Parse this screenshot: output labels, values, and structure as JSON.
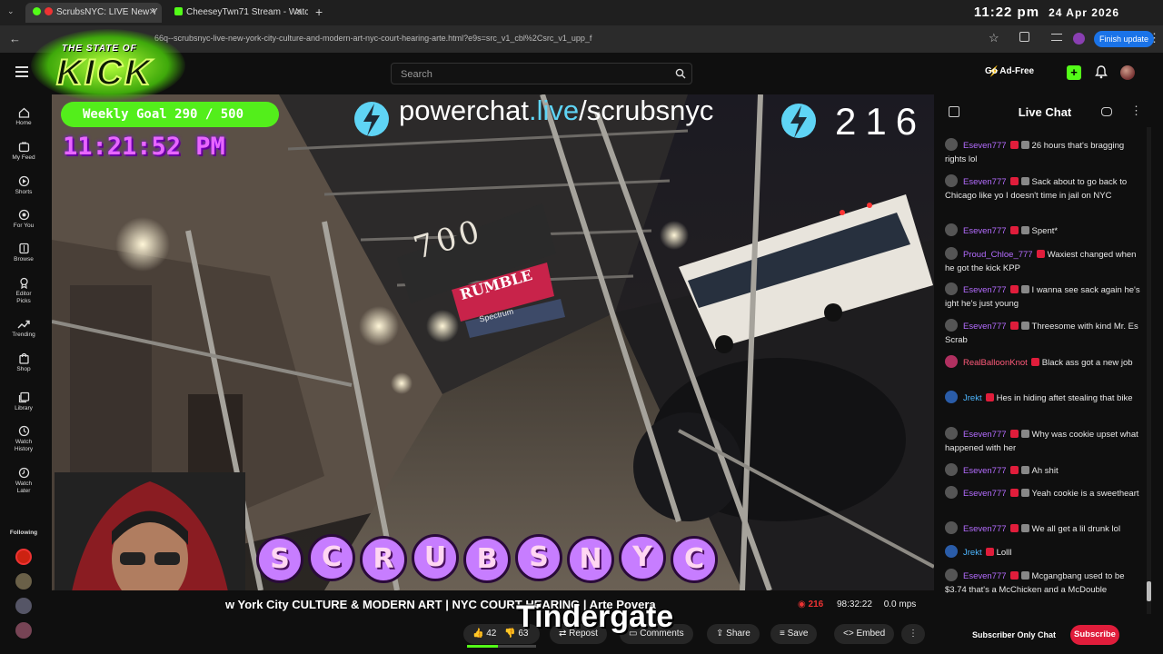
{
  "browser": {
    "tabs": [
      {
        "title": "ScrubsNYC: LIVE New Y",
        "active": true
      },
      {
        "title": "CheeseyTwn71 Stream - Watch",
        "active": false
      }
    ],
    "url": "66q--scrubsnyc-live-new-york-city-culture-and-modern-art-nyc-court-hearing-arte.html?e9s=src_v1_cbl%2Csrc_v1_upp_f",
    "finish_update": "Finish update",
    "clock_time": "11:22 pm",
    "clock_date": "24 Apr 2026"
  },
  "header": {
    "search_placeholder": "Search",
    "go_ad_free": "Go Ad-Free",
    "logo_text_top": "THE STATE OF",
    "logo_text_main": "KICK"
  },
  "sidebar": {
    "items": [
      {
        "label": "Home",
        "icon": "home-icon"
      },
      {
        "label": "My Feed",
        "icon": "feed-icon"
      },
      {
        "label": "Shorts",
        "icon": "shorts-icon"
      },
      {
        "label": "For You",
        "icon": "for-you-icon"
      },
      {
        "label": "Browse",
        "icon": "browse-icon"
      },
      {
        "label": "Editor Picks",
        "icon": "editor-picks-icon"
      },
      {
        "label": "Trending",
        "icon": "trending-icon"
      },
      {
        "label": "Shop",
        "icon": "shop-icon"
      },
      {
        "label": "Library",
        "icon": "library-icon"
      },
      {
        "label": "Watch History",
        "icon": "watch-history-icon"
      },
      {
        "label": "Watch Later",
        "icon": "watch-later-icon"
      }
    ],
    "following_label": "Following"
  },
  "overlay": {
    "weekly_goal": "Weekly Goal 290 / 500",
    "stream_time": "11:21:52 PM",
    "powerchat_prefix": "powerchat",
    "powerchat_tld": ".live",
    "powerchat_path": "/scrubsnyc",
    "viewer_counter": "216",
    "letters": [
      "S",
      "C",
      "R",
      "U",
      "B",
      "S",
      "N",
      "Y",
      "C"
    ],
    "sign_number": "700",
    "sign_rumble": "RUMBLE",
    "sign_spectrum": "Spectrum",
    "tindergate": "Tindergate"
  },
  "stream": {
    "title_visible": "w York City  CULTURE & MODERN ART | NYC COURT HEARING | Arte Povera",
    "viewers": "216",
    "duration": "98:32:22",
    "bitrate": "0.0 mps",
    "likes": "42",
    "dislikes": "63",
    "repost_label": "Repost",
    "comments_label": "Comments",
    "share_label": "Share",
    "save_label": "Save",
    "embed_label": "Embed"
  },
  "chat": {
    "title": "Live Chat",
    "messages": [
      {
        "user": "Eseven777",
        "color": "#b46cff",
        "text": "26 hours that's bragging rights lol"
      },
      {
        "user": "Eseven777",
        "color": "#b46cff",
        "text": "Sack about to go back to Chicago like yo I doesn't time in jail on NYC"
      },
      {
        "user": "Eseven777",
        "color": "#b46cff",
        "text": "Spent*"
      },
      {
        "user": "Proud_Chloe_777",
        "color": "#b46cff",
        "text": "Waxiest changed when he got the kick KPP"
      },
      {
        "user": "Eseven777",
        "color": "#b46cff",
        "text": "I wanna see sack again he's ight he's just young"
      },
      {
        "user": "Eseven777",
        "color": "#b46cff",
        "text": "Threesome with kind Mr. Es Scrab"
      },
      {
        "user": "RealBalloonKnot",
        "color": "#ff5a7a",
        "text": "Black ass got a new job"
      },
      {
        "user": "Jrekt",
        "color": "#4db6ff",
        "text": "Hes in hiding aftet stealing that bike"
      },
      {
        "user": "Eseven777",
        "color": "#b46cff",
        "text": "Why was cookie upset what happened with her"
      },
      {
        "user": "Eseven777",
        "color": "#b46cff",
        "text": "Ah shit"
      },
      {
        "user": "Eseven777",
        "color": "#b46cff",
        "text": "Yeah cookie is a sweetheart"
      },
      {
        "user": "Eseven777",
        "color": "#b46cff",
        "text": "We all get a lil drunk lol"
      },
      {
        "user": "Jrekt",
        "color": "#4db6ff",
        "text": "Lolll"
      },
      {
        "user": "Eseven777",
        "color": "#b46cff",
        "text": "Mcgangbang used to be $3.74 that's a McChicken and a McDouble"
      }
    ],
    "subscriber_only": "Subscriber Only Chat",
    "subscribe": "Subscribe"
  },
  "colors": {
    "kick_green": "#53fc18",
    "subscribe_red": "#e01d3b",
    "letter_bubble": "#c77dff",
    "letter_text": "#ffd6f2"
  }
}
